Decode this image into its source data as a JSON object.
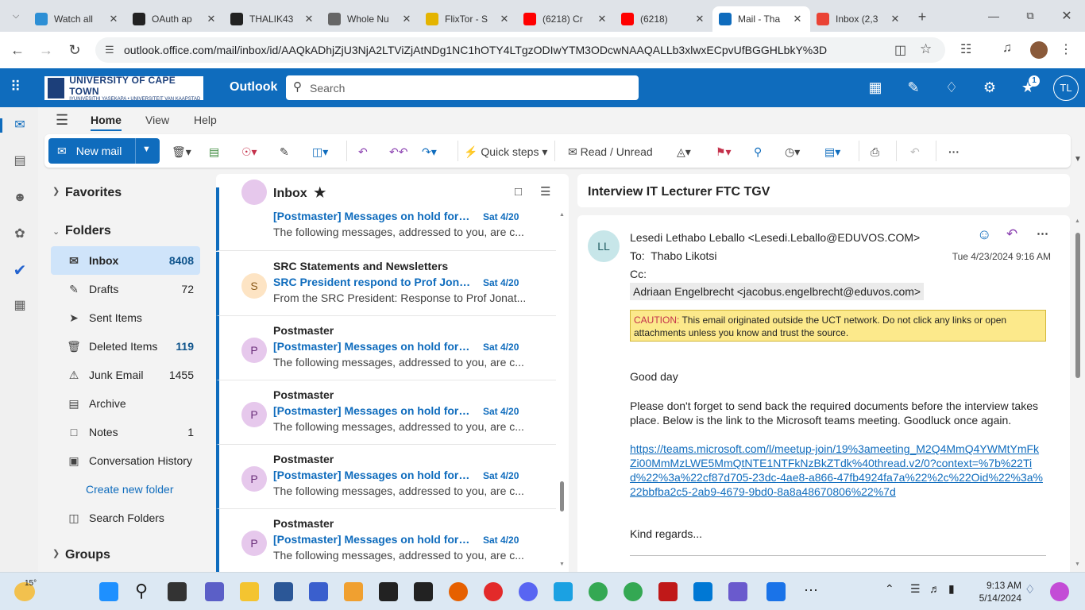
{
  "browser": {
    "tabs": [
      {
        "title": "Watch all",
        "icon": "kodi-icon",
        "color": "#2d8fd5"
      },
      {
        "title": "OAuth ap",
        "icon": "github-icon",
        "color": "#222222"
      },
      {
        "title": "THALIK43",
        "icon": "github-icon",
        "color": "#222222"
      },
      {
        "title": "Whole Nu",
        "icon": "globe-icon",
        "color": "#666666"
      },
      {
        "title": "FlixTor - S",
        "icon": "flixtor-icon",
        "color": "#e4b400"
      },
      {
        "title": "(6218) Cr",
        "icon": "youtube-icon",
        "color": "#ff0000"
      },
      {
        "title": "(6218)",
        "icon": "youtube-icon",
        "color": "#ff0000"
      },
      {
        "title": "Mail - Tha",
        "icon": "outlook-icon",
        "color": "#0f6cbd"
      },
      {
        "title": "Inbox (2,3",
        "icon": "gmail-icon",
        "color": "#ea4335"
      }
    ],
    "url": "outlook.office.com/mail/inbox/id/AAQkADhjZjU3NjA2LTViZjAtNDg1NC1hOTY4LTgzODIwYTM3ODcwNAAQALLb3xlwxECpvUfBGGHLbkY%3D"
  },
  "header": {
    "org_name": "UNIVERSITY OF CAPE TOWN",
    "org_sub": "IYUNIVESITHI YASEKAPA • UNIVERSITEIT VAN KAAPSTAD",
    "app": "Outlook",
    "search_placeholder": "Search",
    "badge": "1",
    "avatar": "TL"
  },
  "ribbon": {
    "tabs": [
      "Home",
      "View",
      "Help"
    ],
    "new_mail": "New mail",
    "quick_steps": "Quick steps",
    "read_unread": "Read / Unread",
    "more": "···"
  },
  "folders": {
    "favorites": "Favorites",
    "folders_label": "Folders",
    "items": [
      {
        "name": "Inbox",
        "count": "8408"
      },
      {
        "name": "Drafts",
        "count": "72"
      },
      {
        "name": "Sent Items",
        "count": ""
      },
      {
        "name": "Deleted Items",
        "count": "119"
      },
      {
        "name": "Junk Email",
        "count": "1455"
      },
      {
        "name": "Archive",
        "count": ""
      },
      {
        "name": "Notes",
        "count": "1"
      },
      {
        "name": "Conversation History",
        "count": ""
      }
    ],
    "create_folder": "Create new folder",
    "search_folders": "Search Folders",
    "groups": "Groups"
  },
  "list": {
    "title": "Inbox",
    "partial": {
      "subject": "[Postmaster] Messages on hold for lk...",
      "date": "Sat 4/20",
      "preview": "The following messages, addressed to you, are c..."
    },
    "messages": [
      {
        "initial": "S",
        "sender": "SRC Statements and Newsletters",
        "subject": "SRC President respond to Prof Jonat...",
        "date": "Sat 4/20",
        "preview": "From the SRC President: Response to Prof Jonat...",
        "avatar_color": "#fde4c4",
        "avatar_text": "#8a5a1a"
      },
      {
        "initial": "P",
        "sender": "Postmaster",
        "subject": "[Postmaster] Messages on hold for lk...",
        "date": "Sat 4/20",
        "preview": "The following messages, addressed to you, are c...",
        "avatar_color": "#e6c8ec",
        "avatar_text": "#6b2f7a"
      },
      {
        "initial": "P",
        "sender": "Postmaster",
        "subject": "[Postmaster] Messages on hold for lk...",
        "date": "Sat 4/20",
        "preview": "The following messages, addressed to you, are c...",
        "avatar_color": "#e6c8ec",
        "avatar_text": "#6b2f7a"
      },
      {
        "initial": "P",
        "sender": "Postmaster",
        "subject": "[Postmaster] Messages on hold for lk...",
        "date": "Sat 4/20",
        "preview": "The following messages, addressed to you, are c...",
        "avatar_color": "#e6c8ec",
        "avatar_text": "#6b2f7a"
      },
      {
        "initial": "P",
        "sender": "Postmaster",
        "subject": "[Postmaster] Messages on hold for lk...",
        "date": "Sat 4/20",
        "preview": "The following messages, addressed to you, are c...",
        "avatar_color": "#e6c8ec",
        "avatar_text": "#6b2f7a"
      }
    ]
  },
  "email": {
    "subject": "Interview IT Lecturer FTC TGV",
    "avatar": "LL",
    "from": "Lesedi Lethabo Leballo <Lesedi.Leballo@EDUVOS.COM>",
    "to_label": "To:",
    "to": "Thabo Likotsi",
    "date": "Tue 4/23/2024 9:16 AM",
    "cc_label": "Cc:",
    "cc": "Adriaan Engelbrecht <jacobus.engelbrecht@eduvos.com>",
    "caution_label": "CAUTION:",
    "caution_text": " This email originated outside the UCT network. Do not click any links or open attachments unless you know and trust the source.",
    "greeting": "Good day",
    "body": "Please don't forget to send back the required documents before the interview takes place. Below is the link to the Microsoft teams meeting. Goodluck once again.",
    "link": "https://teams.microsoft.com/l/meetup-join/19%3ameeting_M2Q4MmQ4YWMtYmFkZi00MmMzLWE5MmQtNTE1NTFkNzBkZTdk%40thread.v2/0?context=%7b%22Tid%22%3a%22cf87d705-23dc-4ae8-a866-47fb4924fa7a%22%2c%22Oid%22%3a%22bbfba2c5-2ab9-4679-9bd0-8a8a48670806%22%7d",
    "closing": "Kind regards..."
  },
  "taskbar": {
    "weather": "15°",
    "time": "9:13 AM",
    "date": "5/14/2024"
  },
  "colors": {
    "accent": "#0f6cbd",
    "caution_bg": "#fce98b"
  }
}
